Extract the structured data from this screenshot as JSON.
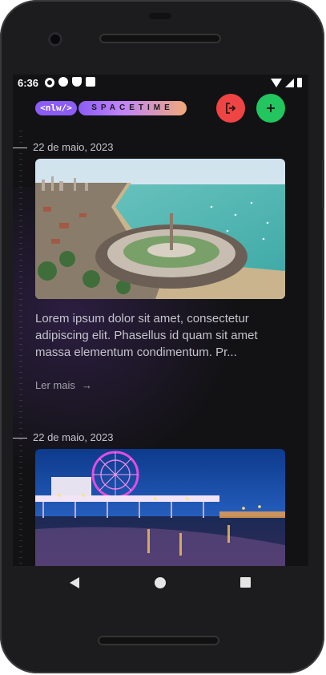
{
  "status_bar": {
    "time": "6:36",
    "left_icons": [
      "gear-icon",
      "a-icon",
      "shield-icon",
      "sd-card-icon"
    ],
    "right_icons": [
      "wifi-icon",
      "signal-icon",
      "battery-icon"
    ]
  },
  "header": {
    "logo_nlw": "<nlw/>",
    "logo_spacetime": "SPACETIME",
    "logout_icon": "logout-icon",
    "add_icon": "plus-icon",
    "logout_color": "#ef4444",
    "add_color": "#22c55e"
  },
  "memories": [
    {
      "date": "22 de maio, 2023",
      "image": "beach-city-aerial-photo",
      "excerpt": "Lorem ipsum dolor sit amet, consectetur adipiscing elit. Phasellus id quam sit amet massa elementum condimentum. Pr...",
      "read_more": "Ler mais",
      "read_more_icon": "arrow-right-icon"
    },
    {
      "date": "22 de maio, 2023",
      "image": "pier-ferris-wheel-night-photo",
      "excerpt": "",
      "read_more": ""
    }
  ],
  "nav_bar": {
    "buttons": [
      "back-icon",
      "home-icon",
      "recent-apps-icon"
    ]
  }
}
